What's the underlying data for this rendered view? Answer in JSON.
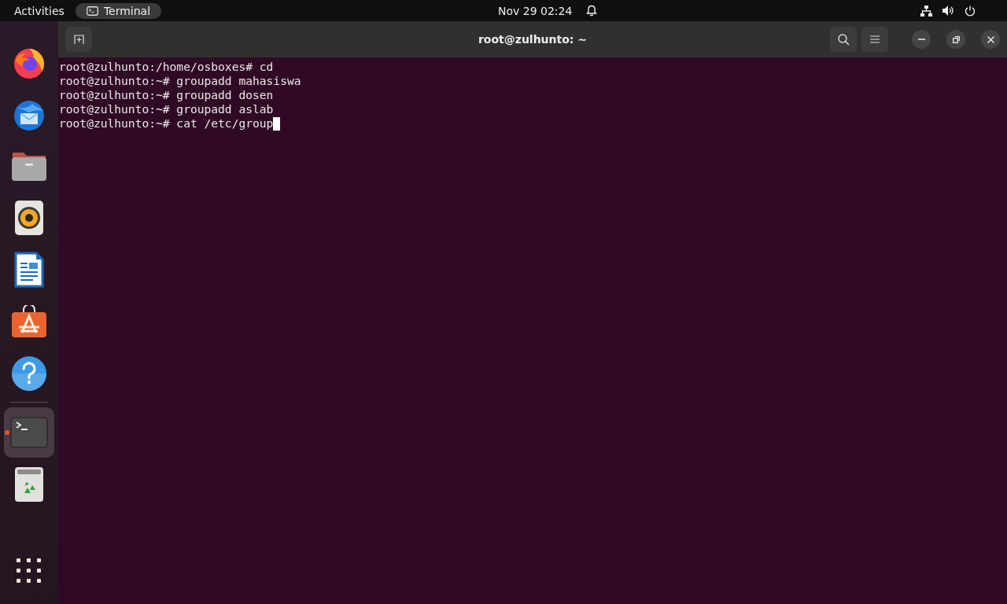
{
  "top_bar": {
    "activities": "Activities",
    "app_menu": "Terminal",
    "clock": "Nov 29  02:24"
  },
  "dock": {
    "apps": [
      {
        "kind": "firefox",
        "selected": false,
        "running": false
      },
      {
        "kind": "thunderbird",
        "selected": false,
        "running": false
      },
      {
        "kind": "files",
        "selected": false,
        "running": false
      },
      {
        "kind": "rhythmbox",
        "selected": false,
        "running": false
      },
      {
        "kind": "writer",
        "selected": false,
        "running": false
      },
      {
        "kind": "software",
        "selected": false,
        "running": false
      },
      {
        "kind": "help",
        "selected": false,
        "running": false
      },
      {
        "kind": "separator",
        "selected": false,
        "running": false
      },
      {
        "kind": "terminal",
        "selected": true,
        "running": true
      },
      {
        "kind": "trash",
        "selected": false,
        "running": false
      },
      {
        "kind": "apps-grid",
        "selected": false,
        "running": false
      }
    ]
  },
  "window": {
    "title": "root@zulhunto: ~",
    "terminal": {
      "lines": [
        "root@zulhunto:/home/osboxes# cd",
        "root@zulhunto:~# groupadd mahasiswa",
        "root@zulhunto:~# groupadd dosen",
        "root@zulhunto:~# groupadd aslab",
        "root@zulhunto:~# cat /etc/group"
      ],
      "cursor": true
    }
  }
}
